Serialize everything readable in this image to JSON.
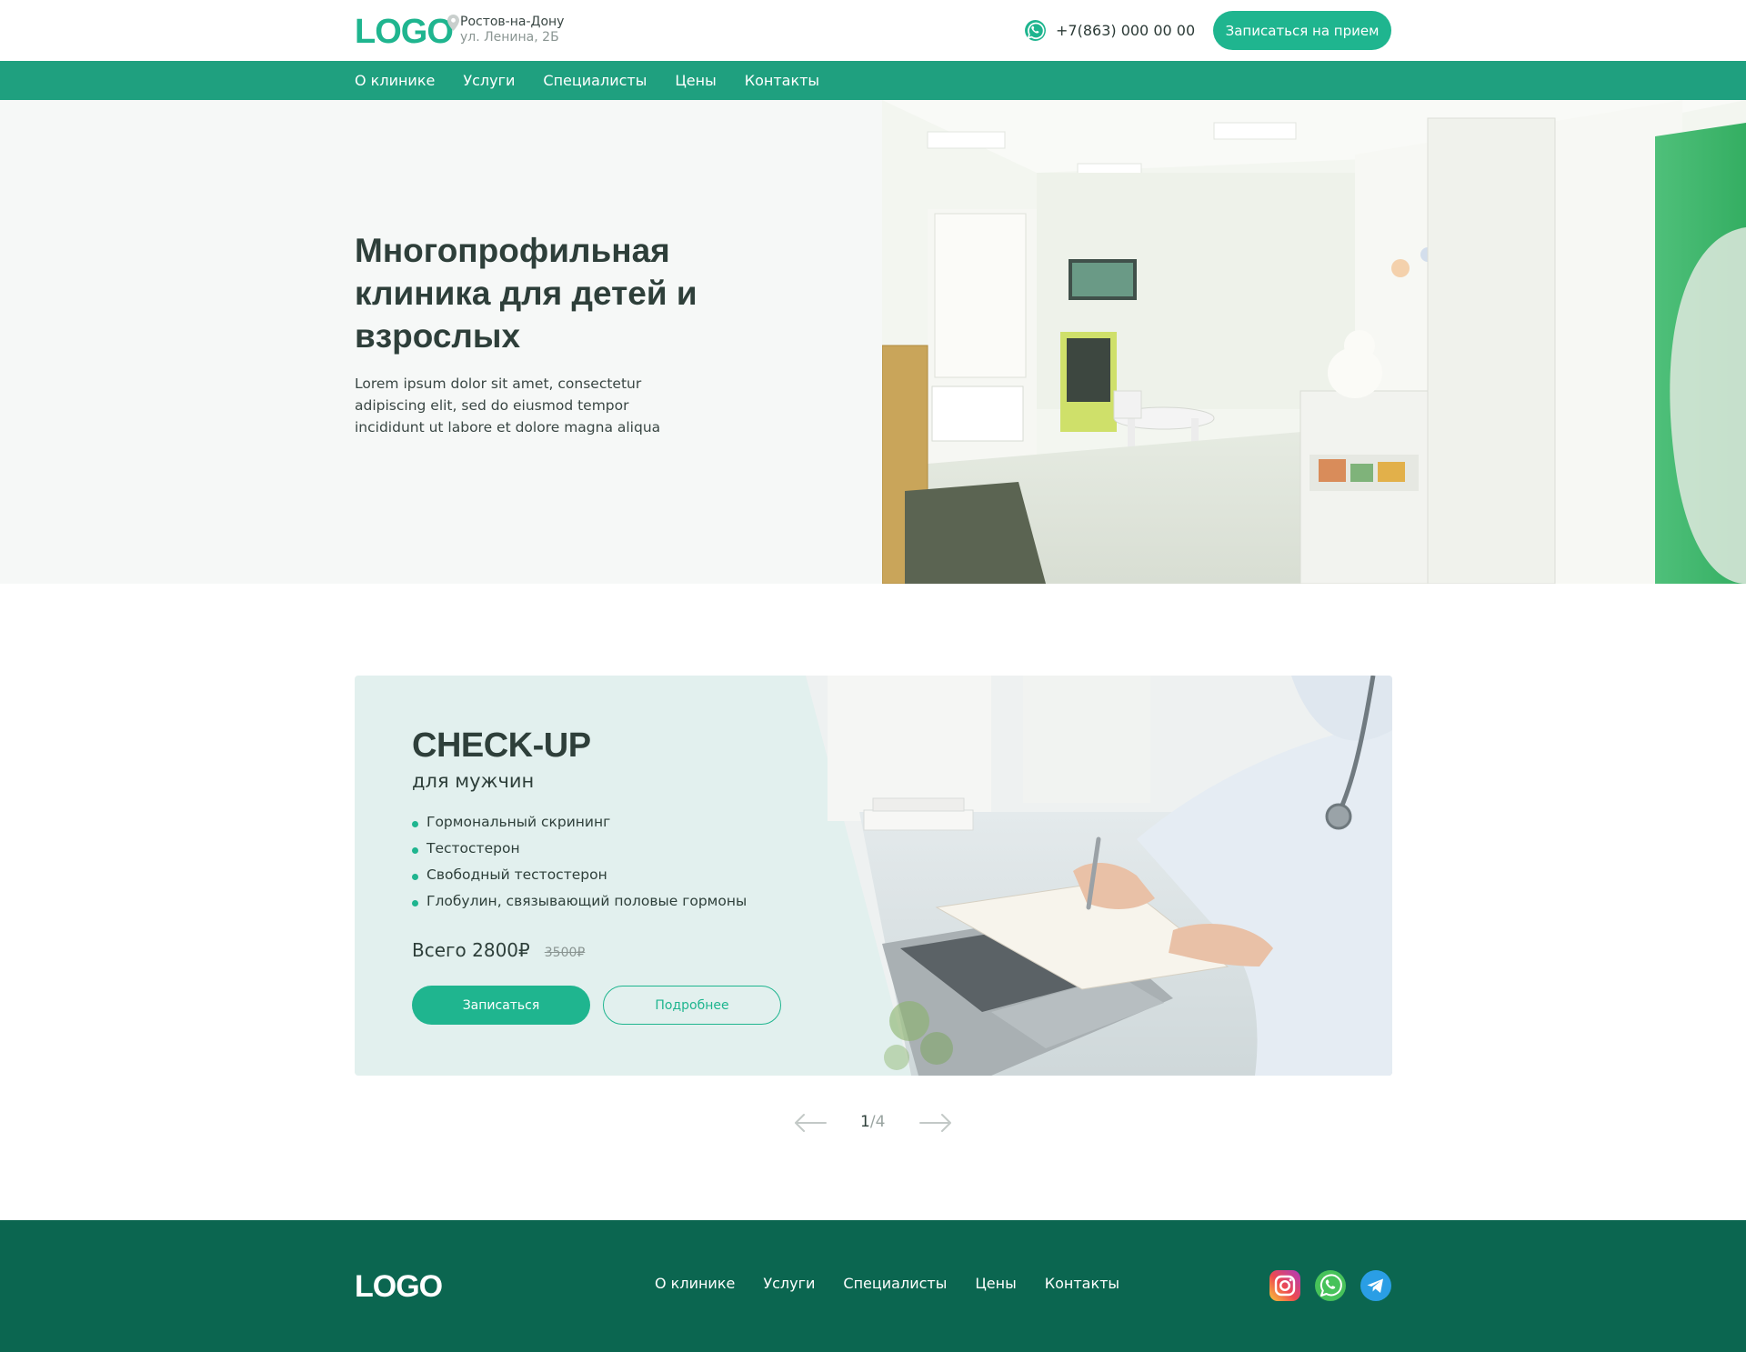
{
  "header": {
    "logo": "LOGO",
    "city": "Ростов-на-Дону",
    "street": "ул. Ленина, 2Б",
    "phone": "+7(863) 000 00 00",
    "book_button": "Записаться на прием",
    "icons": {
      "location": "map-pin-icon",
      "phone": "whatsapp-icon"
    }
  },
  "nav": {
    "items": [
      "О клинике",
      "Услуги",
      "Специалисты",
      "Цены",
      "Контакты"
    ]
  },
  "hero": {
    "title": "Многопрофильная клиника для детей и взрослых",
    "text": "Lorem ipsum dolor sit amet, consectetur adipiscing elit, sed do eiusmod tempor incididunt ut labore et dolore magna aliqua"
  },
  "promo": {
    "title": "CHECK-UP",
    "subtitle": "для мужчин",
    "items": [
      "Гормональный скрининг",
      "Тестостерон",
      "Свободный тестостерон",
      "Глобулин, связывающий половые гормоны"
    ],
    "price_now": "Всего 2800₽",
    "price_old": "3500₽",
    "primary_button": "Записаться",
    "secondary_button": "Подробнее"
  },
  "pager": {
    "current": "1",
    "separator": "/",
    "total": "4",
    "icons": {
      "prev": "arrow-left-icon",
      "next": "arrow-right-icon"
    }
  },
  "footer": {
    "logo": "LOGO",
    "nav": [
      "О клинике",
      "Услуги",
      "Специалисты",
      "Цены",
      "Контакты"
    ],
    "socials": [
      "instagram-icon",
      "whatsapp-icon",
      "telegram-icon"
    ]
  },
  "colors": {
    "accent": "#1fb58f",
    "nav_bg": "#1fa07f",
    "footer_bg": "#0b6650",
    "hero_bg": "#f6f8f7",
    "promo_bg": "#e2f0ee",
    "text_dark": "#2e3f3a"
  }
}
